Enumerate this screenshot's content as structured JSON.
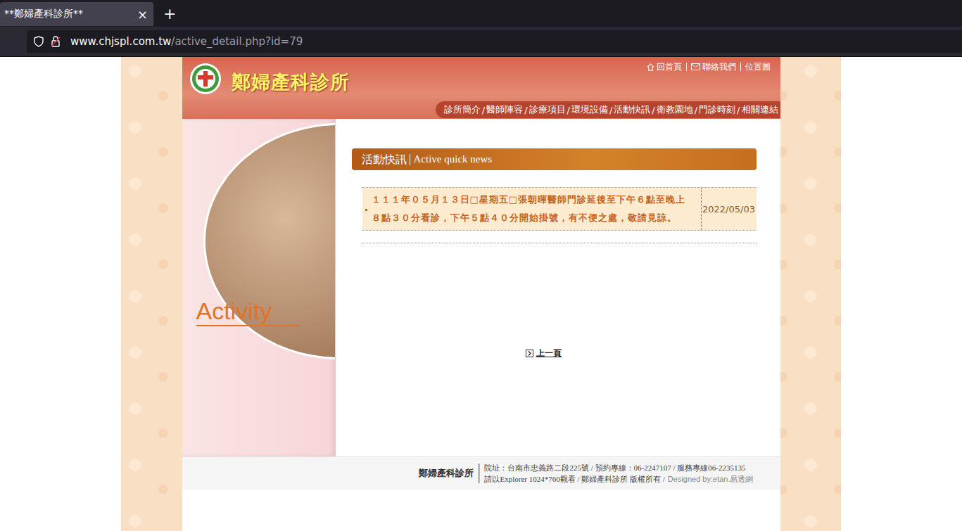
{
  "browser": {
    "tab": {
      "title": "**鄭婦產科診所**",
      "close": "×",
      "selected": true
    },
    "new_tab": "+",
    "url": {
      "domain": "www.chjspl.com.tw",
      "path": "/active_detail.php?id=79"
    }
  },
  "site": {
    "name": "鄭婦產科診所",
    "top_links": [
      "回首頁",
      "聯絡我們",
      "位置圖"
    ],
    "nav_separator": "/",
    "nav": [
      "診所簡介",
      "醫師陣容",
      "診療項目",
      "環境設備",
      "活動快訊",
      "衛教園地",
      "門診時刻",
      "相關連結"
    ],
    "sidebar_label": "Activity"
  },
  "section": {
    "title": "活動快訊",
    "subtitle": "Active quick news"
  },
  "news": [
    {
      "text": "１１１年０５月１３日□星期五□張朝暉醫師門診延後至下午６點至晚上８點３０分看診，下午５點４０分開始掛號，有不便之處，敬請見諒。",
      "date": "2022/05/03"
    }
  ],
  "back_link": "上一頁",
  "footer": {
    "name": "鄭婦產科診所",
    "address": "院址：台南市忠義路二段225號 / 預約專線：06-2247107 / 服務專線06-2235135",
    "notice": "請以Explorer 1024*760觀看 / 鄭婦產科診所 版權所有 /",
    "credit": "Designed by:etan.易透網"
  }
}
